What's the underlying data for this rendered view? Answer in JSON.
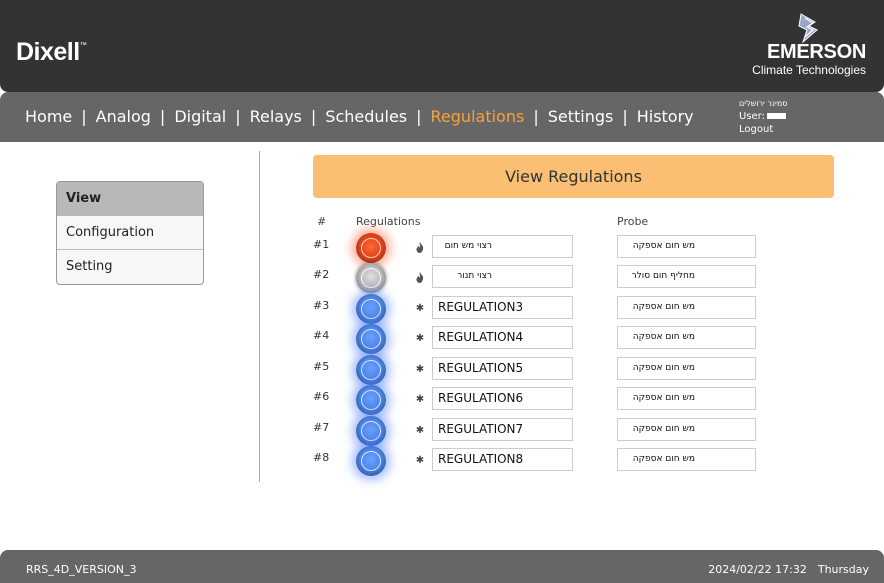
{
  "header": {
    "brand_left": "Dixell",
    "brand_left_tm": "™",
    "brand_right": "EMERSON",
    "brand_right_sub": "Climate Technologies",
    "brand_mark_icon": "emerson-logo-icon"
  },
  "nav": {
    "items": [
      {
        "label": "Home"
      },
      {
        "label": "Analog"
      },
      {
        "label": "Digital"
      },
      {
        "label": "Relays"
      },
      {
        "label": "Schedules"
      },
      {
        "label": "Regulations",
        "active": true
      },
      {
        "label": "Settings"
      },
      {
        "label": "History"
      }
    ],
    "separator": "|",
    "active_color": "#f7a23a"
  },
  "user": {
    "site_name": "סמינר ירושלים",
    "user_label": "User:",
    "logout_label": "Logout"
  },
  "sidebar": {
    "items": [
      {
        "label": "View",
        "active": true
      },
      {
        "label": "Configuration"
      },
      {
        "label": "Setting"
      }
    ]
  },
  "main": {
    "title": "View Regulations",
    "columns": {
      "num": "#",
      "regulations": "Regulations",
      "probe": "Probe"
    },
    "rows": [
      {
        "num": "#1",
        "state": "on",
        "mode_icon": "flame-icon",
        "name": "רצוי מש חום",
        "probe": "מש חום אספקה"
      },
      {
        "num": "#2",
        "state": "off",
        "mode_icon": "flame-icon",
        "name": "רצוי תנור",
        "probe": "מחליף חום סולר"
      },
      {
        "num": "#3",
        "state": "cool",
        "mode_icon": "snowflake-icon",
        "name": "REGULATION3",
        "probe": "מש חום אספקה"
      },
      {
        "num": "#4",
        "state": "cool",
        "mode_icon": "snowflake-icon",
        "name": "REGULATION4",
        "probe": "מש חום אספקה"
      },
      {
        "num": "#5",
        "state": "cool",
        "mode_icon": "snowflake-icon",
        "name": "REGULATION5",
        "probe": "מש חום אספקה"
      },
      {
        "num": "#6",
        "state": "cool",
        "mode_icon": "snowflake-icon",
        "name": "REGULATION6",
        "probe": "מש חום אספקה"
      },
      {
        "num": "#7",
        "state": "cool",
        "mode_icon": "snowflake-icon",
        "name": "REGULATION7",
        "probe": "מש חום אספקה"
      },
      {
        "num": "#8",
        "state": "cool",
        "mode_icon": "snowflake-icon",
        "name": "REGULATION8",
        "probe": "מש חום אספקה"
      }
    ]
  },
  "footer": {
    "version": "RRS_4D_VERSION_3",
    "datetime": "2024/02/22 17:32",
    "weekday": "Thursday"
  },
  "colors": {
    "header_bg": "#333333",
    "nav_bg": "#666666",
    "title_bg": "#fbbf73",
    "led_on": "#e0461e",
    "led_cool": "#4f86e8",
    "led_off": "#bcbcbc"
  }
}
